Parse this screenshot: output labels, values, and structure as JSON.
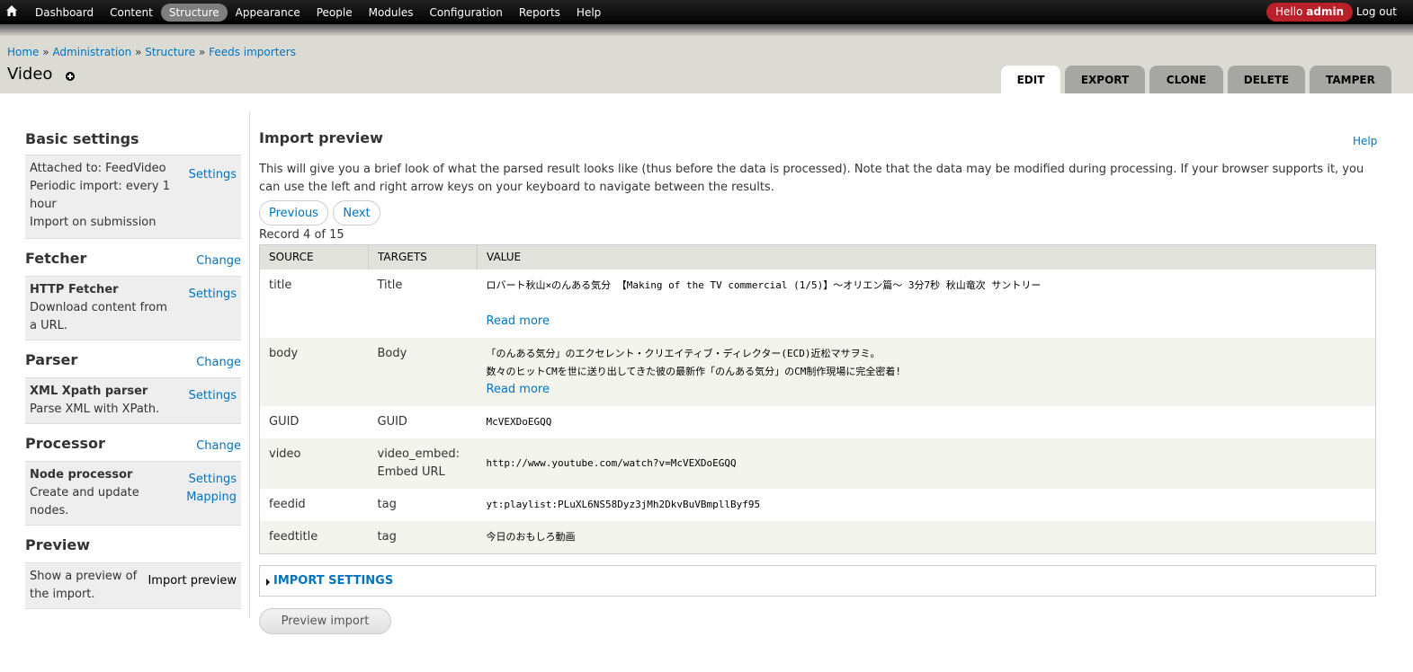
{
  "toolbar": {
    "menu": [
      "Dashboard",
      "Content",
      "Structure",
      "Appearance",
      "People",
      "Modules",
      "Configuration",
      "Reports",
      "Help"
    ],
    "hello_prefix": "Hello",
    "hello_user": "admin",
    "logout": "Log out"
  },
  "breadcrumb": [
    "Home",
    "Administration",
    "Structure",
    "Feeds importers"
  ],
  "breadcrumb_sep": "»",
  "page_title": "Video",
  "tabs": [
    "EDIT",
    "EXPORT",
    "CLONE",
    "DELETE",
    "TAMPER"
  ],
  "sidebar": {
    "basic": {
      "title": "Basic settings",
      "lines": [
        "Attached to: FeedVideo",
        "Periodic import: every 1 hour",
        "Import on submission"
      ],
      "link": "Settings"
    },
    "fetcher": {
      "title": "Fetcher",
      "change": "Change",
      "name": "HTTP Fetcher",
      "desc": "Download content from a URL.",
      "link": "Settings"
    },
    "parser": {
      "title": "Parser",
      "change": "Change",
      "name": "XML Xpath parser",
      "desc": "Parse XML with XPath.",
      "link": "Settings"
    },
    "processor": {
      "title": "Processor",
      "change": "Change",
      "name": "Node processor",
      "desc": "Create and update nodes.",
      "link1": "Settings",
      "link2": "Mapping"
    },
    "preview": {
      "title": "Preview",
      "desc": "Show a preview of the import.",
      "link": "Import preview"
    }
  },
  "main": {
    "title": "Import preview",
    "help": "Help",
    "description": "This will give you a brief look of what the parsed result looks like (thus before the data is processed). Note that the data may be modified during processing. If your browser supports it, you can use the left and right arrow keys on your keyboard to navigate between the results.",
    "previous": "Previous",
    "next": "Next",
    "record": "Record 4 of 15",
    "table": {
      "headers": [
        "SOURCE",
        "TARGETS",
        "VALUE"
      ],
      "rows": [
        {
          "source": "title",
          "target": "Title",
          "value": "ロバート秋山×のんある気分 【Making of the TV commercial (1/5)】〜オリエン篇〜 3分7秒 秋山竜次 サントリー",
          "value2": "",
          "readmore": "Read more"
        },
        {
          "source": "body",
          "target": "Body",
          "value": "「のんある気分」のエクセレント・クリエイティブ・ディレクター(ECD)近松マサヲミ。",
          "value2": "数々のヒットCMを世に送り出してきた彼の最新作「のんある気分」のCM制作現場に完全密着!",
          "readmore": "Read more"
        },
        {
          "source": "GUID",
          "target": "GUID",
          "value": "McVEXDoEGQQ",
          "value2": "",
          "readmore": ""
        },
        {
          "source": "video",
          "target": "video_embed: Embed URL",
          "value": "http://www.youtube.com/watch?v=McVEXDoEGQQ",
          "value2": "",
          "readmore": ""
        },
        {
          "source": "feedid",
          "target": "tag",
          "value": "yt:playlist:PLuXL6NS58Dyz3jMh2DkvBuVBmpllByf95",
          "value2": "",
          "readmore": ""
        },
        {
          "source": "feedtitle",
          "target": "tag",
          "value": "今日のおもしろ動画",
          "value2": "",
          "readmore": ""
        }
      ]
    },
    "import_settings": "IMPORT SETTINGS",
    "preview_button": "Preview import"
  }
}
